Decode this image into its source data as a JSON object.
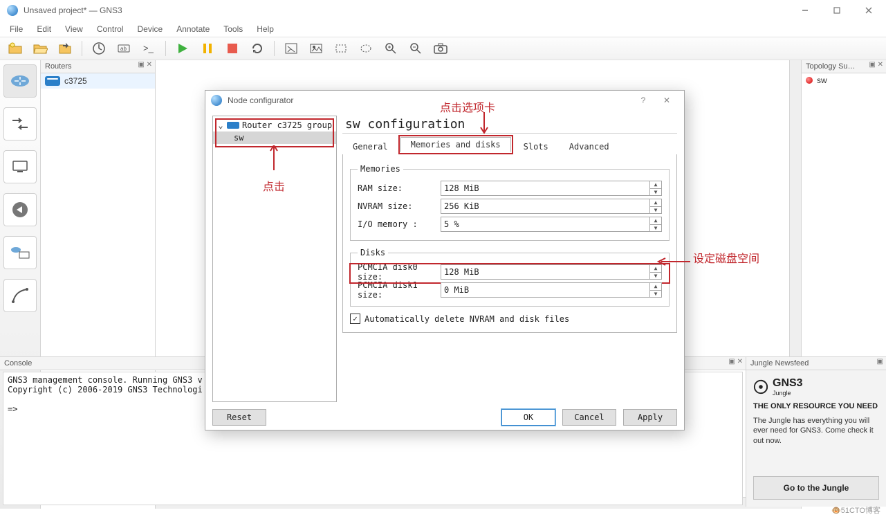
{
  "window": {
    "title": "Unsaved project* — GNS3",
    "menus": [
      "File",
      "Edit",
      "View",
      "Control",
      "Device",
      "Annotate",
      "Tools",
      "Help"
    ]
  },
  "routersPanel": {
    "title": "Routers",
    "item": "c3725",
    "controls": "▣ ✕"
  },
  "topology": {
    "title": "Topology Su…",
    "item": "sw",
    "controls": "▣ ✕"
  },
  "console": {
    "title": "Console",
    "controls": "▣ ✕",
    "lines": "GNS3 management console. Running GNS3 v\nCopyright (c) 2006-2019 GNS3 Technologi\n\n=>"
  },
  "jungle": {
    "title": "Jungle Newsfeed",
    "controls": "▣",
    "brand": "GNS3",
    "brandSub": "Jungle",
    "headline": "THE ONLY RESOURCE YOU NEED",
    "body": "The Jungle has everything you will ever need for GNS3. Come check it out now.",
    "button": "Go to the Jungle"
  },
  "dialog": {
    "title": "Node configurator",
    "help": "?",
    "close": "✕",
    "tree": {
      "group": "Router c3725 group",
      "child": "sw"
    },
    "paneTitle": "sw configuration",
    "tabs": {
      "general": "General",
      "mem": "Memories and disks",
      "slots": "Slots",
      "adv": "Advanced"
    },
    "memLegend": "Memories",
    "ramLabel": "RAM size:",
    "ramVal": "128 MiB",
    "nvramLabel": "NVRAM size:",
    "nvramVal": "256 KiB",
    "ioLabel": "I/O memory :",
    "ioVal": "5 %",
    "diskLegend": "Disks",
    "d0Label": "PCMCIA disk0 size:",
    "d0Val": "128 MiB",
    "d1Label": "PCMCIA disk1 size:",
    "d1Val": "0 MiB",
    "autoDel": "Automatically delete NVRAM and disk files",
    "reset": "Reset",
    "ok": "OK",
    "cancel": "Cancel",
    "apply": "Apply"
  },
  "annot": {
    "clickTab": "点击选项卡",
    "click": "点击",
    "setDisk": "设定磁盘空间"
  },
  "watermark": "🐵51CTO博客"
}
